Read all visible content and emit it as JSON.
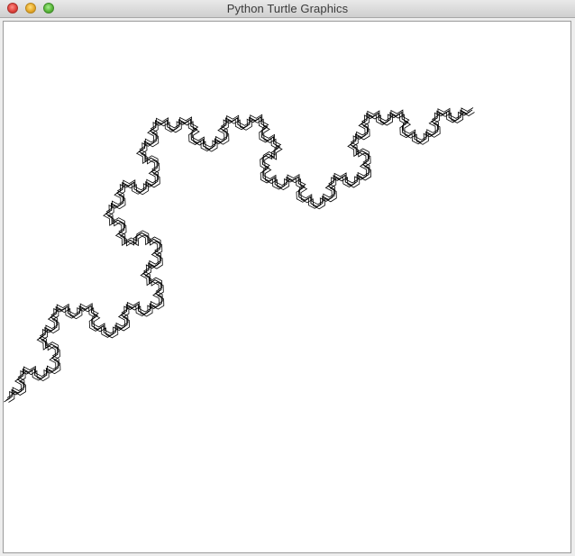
{
  "window": {
    "title": "Python Turtle Graphics"
  },
  "canvas": {
    "background": "#ffffff",
    "stroke_color": "#000000"
  }
}
